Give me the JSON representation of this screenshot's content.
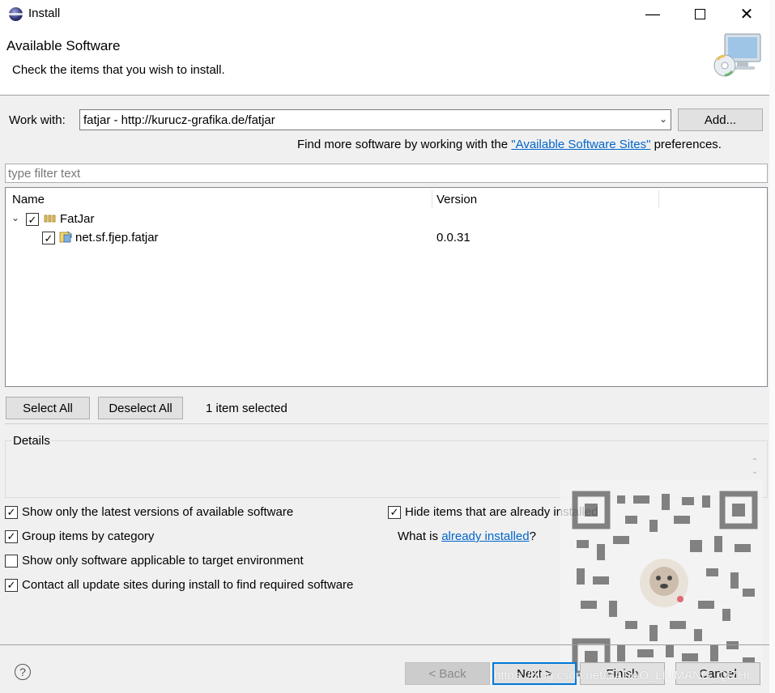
{
  "window": {
    "title": "Install",
    "controls": [
      "minimize-icon",
      "maximize-icon",
      "close-icon"
    ]
  },
  "header": {
    "title": "Available Software",
    "subtitle": "Check the items that you wish to install."
  },
  "work_with": {
    "label": "Work with:",
    "value": "fatjar - http://kurucz-grafika.de/fatjar",
    "add_button": "Add...",
    "find_more_prefix": "Find more software by working with the ",
    "find_more_link": "\"Available Software Sites\"",
    "find_more_suffix": " preferences."
  },
  "filter": {
    "placeholder": "type filter text"
  },
  "tree": {
    "columns": [
      "Name",
      "Version"
    ],
    "items": [
      {
        "name": "FatJar",
        "version": "",
        "checked": true,
        "expanded": true,
        "level": 0,
        "icon": "category-icon"
      },
      {
        "name": "net.sf.fjep.fatjar",
        "version": "0.0.31",
        "checked": true,
        "level": 1,
        "icon": "feature-icon"
      }
    ]
  },
  "selection": {
    "select_all": "Select All",
    "deselect_all": "Deselect All",
    "status": "1 item selected"
  },
  "details": {
    "label": "Details"
  },
  "options": {
    "latest_versions": {
      "label": "Show only the latest versions of available software",
      "checked": true
    },
    "group_by_category": {
      "label": "Group items by category",
      "checked": true
    },
    "target_env": {
      "label": "Show only software applicable to target environment",
      "checked": false
    },
    "contact_sites": {
      "label": "Contact all update sites during install to find required software",
      "checked": true
    },
    "hide_installed": {
      "label": "Hide items that are already installed",
      "checked": true
    },
    "what_is_prefix": "What is ",
    "what_is_link": "already installed",
    "what_is_suffix": "?"
  },
  "footer": {
    "back": "< Back",
    "next": "Next >",
    "finish": "Finish",
    "cancel": "Cancel"
  },
  "watermark": "https://blog.csdn.net/BADAO_LIUMANG_QIZHI",
  "colors": {
    "link": "#0066cc",
    "default_button_border": "#0078d7",
    "background": "#f0f0f0"
  }
}
